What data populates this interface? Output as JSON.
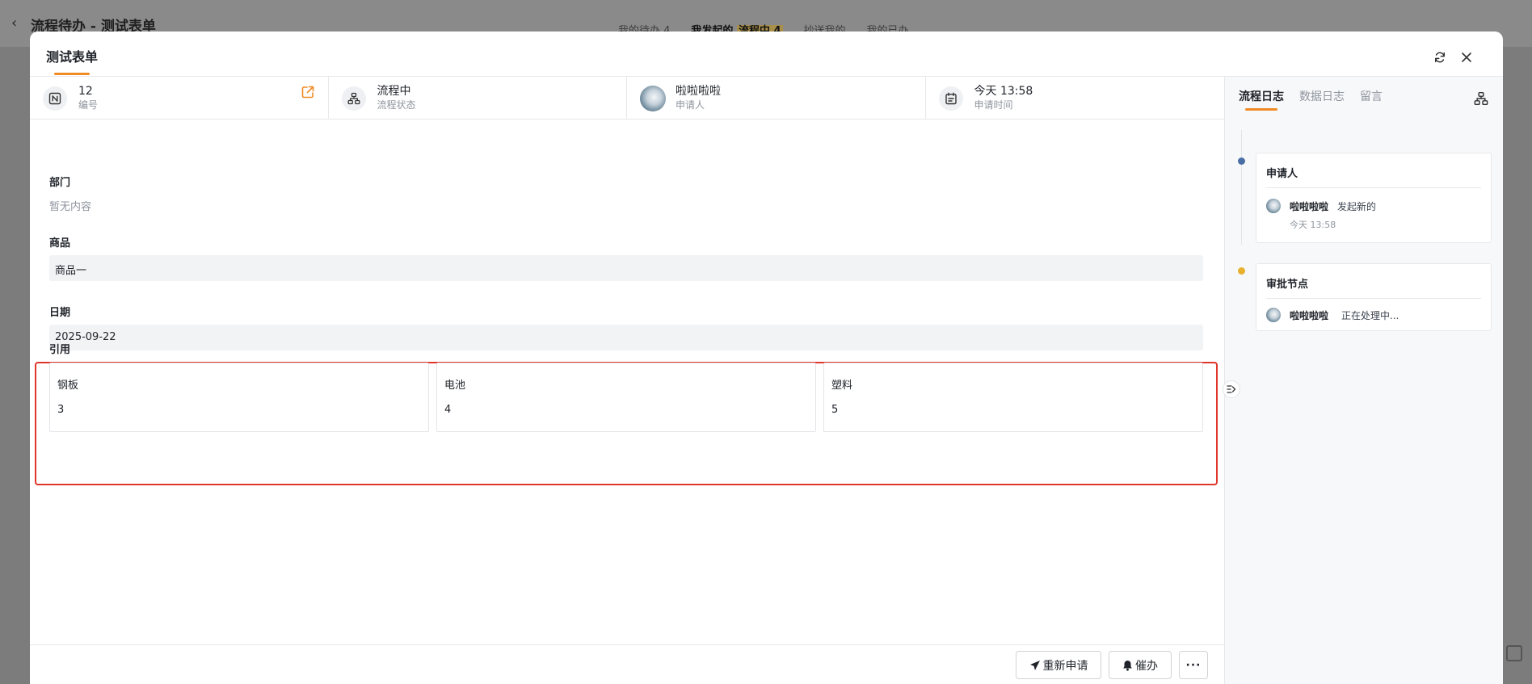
{
  "background": {
    "back_glyph": "‹",
    "title": "流程待办 - 测试表单",
    "tabs": [
      {
        "label": "我的待办 4",
        "active": false
      },
      {
        "label_pre": "我发起的 ",
        "label_hl": "流程中 4",
        "active": true
      },
      {
        "label": "抄送我的",
        "active": false
      },
      {
        "label": "我的已办",
        "active": false
      }
    ]
  },
  "modal": {
    "title": "测试表单",
    "refresh_icon": "refresh-icon",
    "close_icon": "close-icon"
  },
  "info": {
    "number": {
      "value": "12",
      "label": "编号"
    },
    "status": {
      "value": "流程中",
      "label": "流程状态"
    },
    "applicant": {
      "value": "啦啦啦啦",
      "label": "申请人"
    },
    "time": {
      "value": "今天 13:58",
      "label": "申请时间"
    }
  },
  "form": {
    "department": {
      "label": "部门",
      "empty": "暂无内容"
    },
    "product": {
      "label": "商品",
      "value": "商品一"
    },
    "date": {
      "label": "日期",
      "value": "2025-09-22"
    },
    "reference": {
      "label": "引用",
      "items": [
        {
          "name": "钢板",
          "qty": "3"
        },
        {
          "name": "电池",
          "qty": "4"
        },
        {
          "name": "塑料",
          "qty": "5"
        }
      ]
    }
  },
  "footer": {
    "resubmit": "重新申请",
    "urge": "催办",
    "more": "···"
  },
  "right_panel": {
    "tabs": [
      {
        "label": "流程日志",
        "active": true
      },
      {
        "label": "数据日志",
        "active": false
      },
      {
        "label": "留言",
        "active": false
      }
    ],
    "logs": [
      {
        "title": "申请人",
        "user": "啦啦啦啦",
        "action": "发起新的",
        "time": "今天 13:58",
        "dot": "#4a6fa5"
      },
      {
        "title": "审批节点",
        "user": "啦啦啦啦",
        "action": "正在处理中...",
        "dot": "#e8b02c"
      }
    ]
  },
  "colors": {
    "accent": "#f08a24",
    "highlight_border": "#e0352b"
  }
}
